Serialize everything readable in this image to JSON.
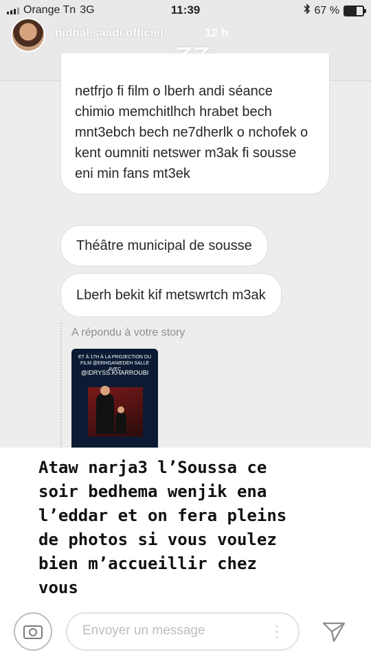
{
  "status_bar": {
    "carrier": "Orange Tn",
    "network": "3G",
    "time": "11:39",
    "bluetooth_icon": "bluetooth-icon",
    "battery": "67 %",
    "battery_level": 0.67
  },
  "header": {
    "username": "nidhal.saadi.officiel",
    "time_ago": "12 h",
    "sticker": "ZZ"
  },
  "messages": [
    {
      "text": "netfrjo fi film o lberh andi séance chimio memchitlhch hrabet bech mnt3ebch bech ne7dherlk o nchofek o kent oumniti netswer m3ak fi sousse eni min fans mt3ek"
    },
    {
      "text": "Théâtre municipal de sousse"
    },
    {
      "text": "Lberh bekit kif metswrtch m3ak"
    }
  ],
  "reply": {
    "label": "A répondu à votre story",
    "thumbnail_text": "ET À 17H À LA PROJECTION DU FILM @ERHGANIEDEH SALLE AVEC",
    "thumbnail_handle": "@IDRYSS.KHARROUBI"
  },
  "caption": {
    "text": "Ataw narja3 l’Soussa ce\nsoir bedhema wenjik ena\nl’eddar et on fera pleins\nde photos si vous voulez\nbien m’accueillir chez\nvous"
  },
  "footer": {
    "camera_icon": "camera-icon",
    "placeholder": "Envoyer un message",
    "more_icon": "more-icon",
    "send_icon": "send-icon"
  },
  "colors": {
    "background": "#ececec",
    "bubble": "#ffffff",
    "text": "#262626",
    "muted": "#8e8e8e"
  }
}
